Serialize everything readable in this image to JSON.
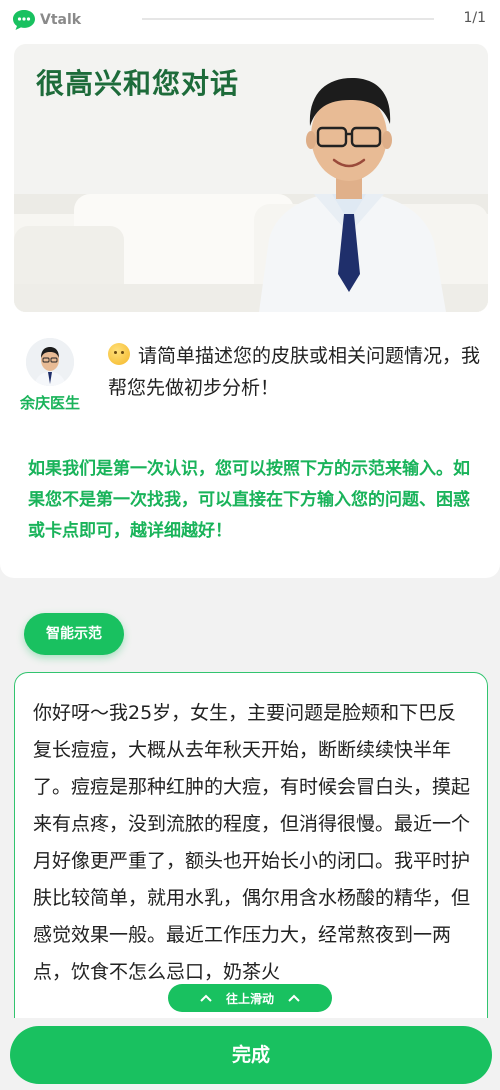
{
  "app": {
    "logo_text": "Vtalk",
    "page_counter": "1/1"
  },
  "hero": {
    "title": "很高兴和您对话"
  },
  "doctor": {
    "name": "余庆医生"
  },
  "message": {
    "text": "请简单描述您的皮肤或相关问题情况，我帮您先做初步分析！"
  },
  "hint": {
    "text": "如果我们是第一次认识，您可以按照下方的示范来输入。如果您不是第一次找我，可以直接在下方输入您的问题、困惑或卡点即可，越详细越好！"
  },
  "demo_button": {
    "label": "智能示范"
  },
  "input": {
    "value": "你好呀～我25岁，女生，主要问题是脸颊和下巴反复长痘痘，大概从去年秋天开始，断断续续快半年了。痘痘是那种红肿的大痘，有时候会冒白头，摸起来有点疼，没到流脓的程度，但消得很慢。最近一个月好像更严重了，额头也开始长小的闭口。我平时护肤比较简单，就用水乳，偶尔用含水杨酸的精华，但感觉效果一般。最近工作压力大，经常熬夜到一两点，饮食不怎么忌口，奶茶火"
  },
  "scroll_hint": {
    "label": "往上滑动"
  },
  "done_button": {
    "label": "完成"
  },
  "colors": {
    "accent": "#19c160",
    "title_green": "#1d6b3a",
    "border_green": "#32c46f"
  },
  "icons": {
    "logo": "chat-bubble-icon",
    "emoji": "smile-emoji-icon",
    "chevron": "chevron-up-icon"
  }
}
